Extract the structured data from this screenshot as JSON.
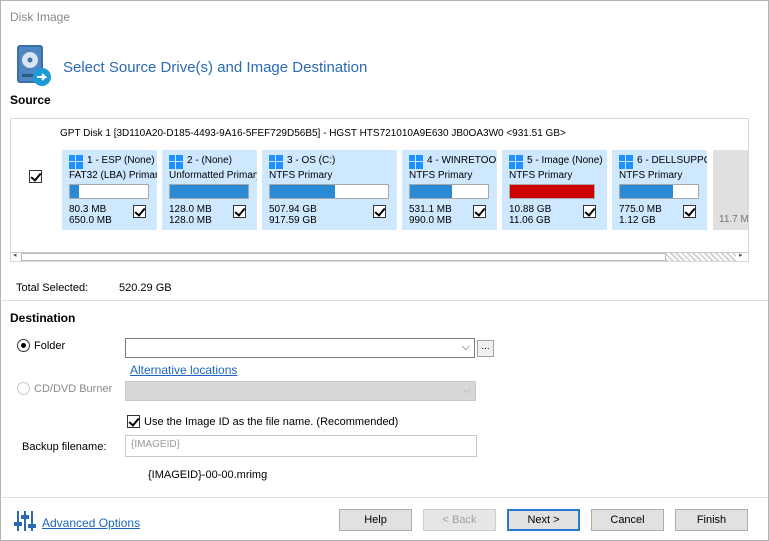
{
  "window": {
    "title": "Disk Image"
  },
  "header": {
    "title": "Select Source Drive(s) and Image Destination",
    "icon": "disk-image-icon"
  },
  "source": {
    "label": "Source",
    "disk_title": "GPT Disk 1 [3D110A20-D185-4493-9A16-5FEF729D56B5] - HGST HTS721010A9E630 JB0OA3W0  <931.51 GB>",
    "disk_checked": true,
    "partitions": [
      {
        "name": "1 - ESP (None)",
        "type": "FAT32 (LBA) Primar",
        "used": "80.3 MB",
        "total": "650.0 MB",
        "fill": 0.12,
        "color": "#2a8ad4",
        "checked": true
      },
      {
        "name": "2 -  (None)",
        "type": "Unformatted Primary",
        "used": "128.0 MB",
        "total": "128.0 MB",
        "fill": 1.0,
        "color": "#2a8ad4",
        "checked": true
      },
      {
        "name": "3 - OS (C:)",
        "type": "NTFS Primary",
        "used": "507.94 GB",
        "total": "917.59 GB",
        "fill": 0.55,
        "color": "#2a8ad4",
        "checked": true
      },
      {
        "name": "4 - WINRETOO",
        "type": "NTFS Primary",
        "used": "531.1 MB",
        "total": "990.0 MB",
        "fill": 0.54,
        "color": "#2a8ad4",
        "checked": true
      },
      {
        "name": "5 - Image (None)",
        "type": "NTFS Primary",
        "used": "10.88 GB",
        "total": "11.06 GB",
        "fill": 1.0,
        "color": "#cc0000",
        "checked": true
      },
      {
        "name": "6 - DELLSUPPO",
        "type": "NTFS Primary",
        "used": "775.0 MB",
        "total": "1.12 GB",
        "fill": 0.68,
        "color": "#2a8ad4",
        "checked": true
      }
    ],
    "unallocated_partial": "11.7 M"
  },
  "totals": {
    "label": "Total Selected:",
    "value": "520.29 GB"
  },
  "destination": {
    "label": "Destination",
    "folder_label": "Folder",
    "folder_value": "",
    "browse_label": "...",
    "alt_locations": "Alternative locations",
    "cd_label": "CD/DVD Burner",
    "use_image_id_label": "Use the Image ID as the file name.  (Recommended)",
    "use_image_id_checked": true,
    "backup_filename_label": "Backup filename:",
    "backup_filename_placeholder": "{IMAGEID}",
    "filename_preview": "{IMAGEID}-00-00.mrimg"
  },
  "footer": {
    "advanced_options": "Advanced Options",
    "buttons": {
      "help": "Help",
      "back": "< Back",
      "next": "Next >",
      "cancel": "Cancel",
      "finish": "Finish"
    }
  }
}
